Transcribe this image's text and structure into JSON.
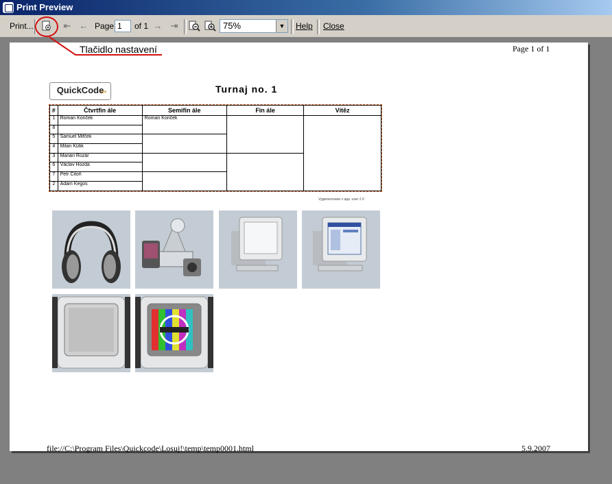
{
  "window": {
    "title": "Print Preview"
  },
  "toolbar": {
    "print_label": "Print...",
    "page_label": "Page",
    "page_value": "1",
    "of_label": "of 1",
    "zoom_value": "75%",
    "help_label": "Help",
    "close_label": "Close"
  },
  "annotation": {
    "label": "Tlačidlo nastavení",
    "color": "#d21010"
  },
  "header": {
    "page_indicator": "Page 1 of 1"
  },
  "report": {
    "logo_text": "QuickCode",
    "logo_small": "IIIIIII",
    "title": "Turnaj no. 1",
    "columns": [
      "#",
      "Čtvrtfin ále",
      "Semifin ále",
      "Fin ále",
      "Vítěz"
    ],
    "quarterfinal": [
      {
        "num": "1",
        "name": "Roman Konček"
      },
      {
        "num": "8",
        "name": ""
      },
      {
        "num": "5",
        "name": "Samuel Mifček"
      },
      {
        "num": "4",
        "name": "Milan Kútik"
      },
      {
        "num": "3",
        "name": "Marián Rozár"
      },
      {
        "num": "6",
        "name": "Václav Hozda"
      },
      {
        "num": "7",
        "name": "Petr Citoň"
      },
      {
        "num": "2",
        "name": "Adam Kegos"
      }
    ],
    "semifinal": [
      "Roman Konček",
      "",
      "",
      ""
    ],
    "final": [
      "",
      ""
    ],
    "winner": "",
    "generated_note": "Vygenerovane v app. user 1.0"
  },
  "images": [
    {
      "name": "headphones"
    },
    {
      "name": "multimedia-devices"
    },
    {
      "name": "crt-monitor-off"
    },
    {
      "name": "crt-monitor-screen"
    },
    {
      "name": "tv-static"
    },
    {
      "name": "tv-test-pattern"
    }
  ],
  "footer": {
    "file_path": "file://C:\\Program Files\\Quickcode\\Losuj!\\temp\\temp0001.html",
    "date": "5.9.2007"
  }
}
